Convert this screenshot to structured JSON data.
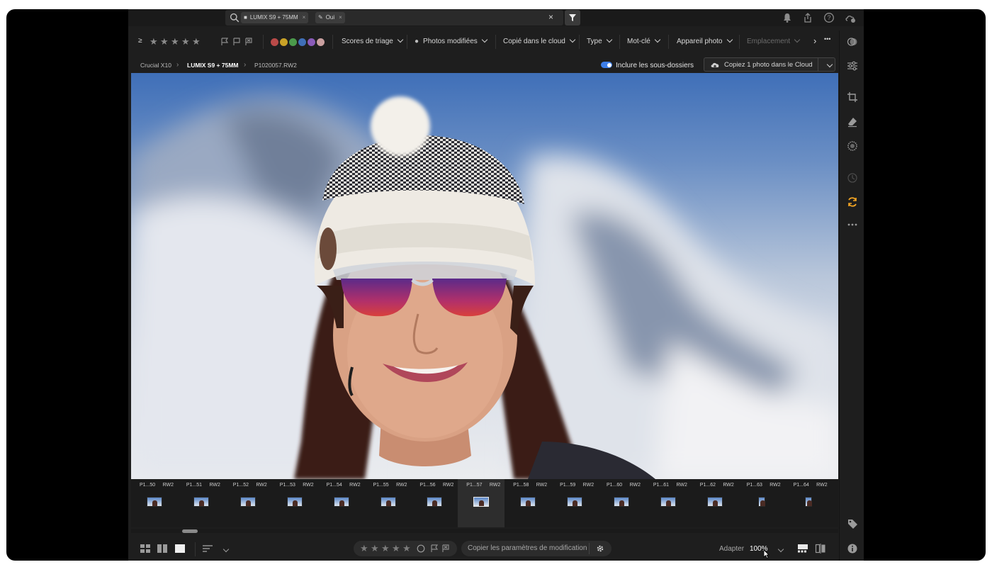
{
  "search": {
    "chips": [
      {
        "icon": "folder-icon",
        "label": "LUMIX S9 + 75MM"
      },
      {
        "icon": "pencil-icon",
        "label": "Oui"
      }
    ],
    "clear": "×"
  },
  "filterbar": {
    "ratings_prefix": "≥",
    "star_count": 5,
    "color_labels": [
      "#b94a48",
      "#c9a227",
      "#4b9a4b",
      "#3f6fb8",
      "#8a5bb8",
      "#caa0a0"
    ],
    "dropdowns": [
      {
        "label": "Scores de triage",
        "enabled": true
      },
      {
        "label": "Photos modifiées",
        "enabled": true
      },
      {
        "label": "Copié dans le cloud",
        "enabled": true
      },
      {
        "label": "Type",
        "enabled": true
      },
      {
        "label": "Mot-clé",
        "enabled": true
      },
      {
        "label": "Appareil photo",
        "enabled": true
      },
      {
        "label": "Emplacement",
        "enabled": false
      }
    ],
    "more": "›",
    "overflow": "•••"
  },
  "breadcrumb": {
    "items": [
      "Crucial X10",
      "LUMIX S9 + 75MM",
      "P1020057.RW2"
    ],
    "separator": "›"
  },
  "include_subfolders": {
    "label": "Inclure les sous-dossiers",
    "on": true
  },
  "copy_cloud": {
    "label": "Copiez 1 photo dans le Cloud"
  },
  "filmstrip": {
    "thumbnails": [
      {
        "name": "P1...50",
        "ext": "RW2"
      },
      {
        "name": "P1...51",
        "ext": "RW2"
      },
      {
        "name": "P1...52",
        "ext": "RW2"
      },
      {
        "name": "P1...53",
        "ext": "RW2"
      },
      {
        "name": "P1...54",
        "ext": "RW2"
      },
      {
        "name": "P1...55",
        "ext": "RW2"
      },
      {
        "name": "P1...56",
        "ext": "RW2"
      },
      {
        "name": "P1...57",
        "ext": "RW2"
      },
      {
        "name": "P1...58",
        "ext": "RW2"
      },
      {
        "name": "P1...59",
        "ext": "RW2"
      },
      {
        "name": "P1...60",
        "ext": "RW2"
      },
      {
        "name": "P1...61",
        "ext": "RW2"
      },
      {
        "name": "P1...62",
        "ext": "RW2"
      },
      {
        "name": "P1...63",
        "ext": "RW2"
      },
      {
        "name": "P1...64",
        "ext": "RW2"
      }
    ],
    "selected_index": 7
  },
  "bottombar": {
    "copy_params": "Copier les paramètres de modification",
    "zoom_label": "Adapter",
    "zoom_value": "100%"
  },
  "colors": {
    "accent": "#3d7ee8",
    "active_tool": "#f5a623",
    "background": "#1e1e1e"
  }
}
